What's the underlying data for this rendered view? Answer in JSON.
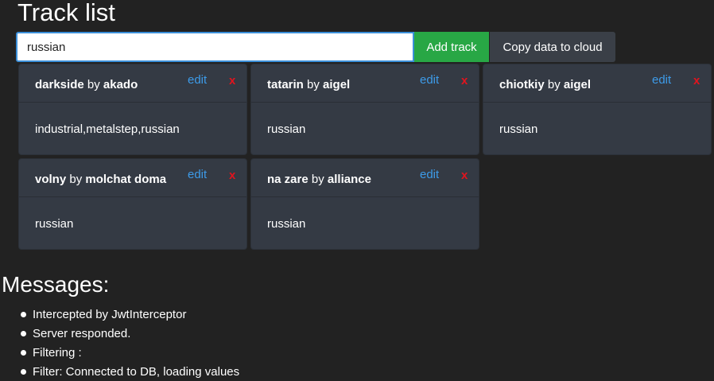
{
  "page": {
    "title": "Track list"
  },
  "toolbar": {
    "search_value": "russian",
    "add_label": "Add track",
    "copy_label": "Copy data to cloud"
  },
  "colors": {
    "background": "#222222",
    "card": "#343a44",
    "add_button": "#28a745",
    "edit_link": "#3d9be9",
    "delete": "#e0141e"
  },
  "tracks": [
    {
      "name": "darkside",
      "by": "by",
      "artist": "akado",
      "edit_label": "edit",
      "delete_label": "x",
      "tags": "industrial,metalstep,russian"
    },
    {
      "name": "tatarin",
      "by": "by",
      "artist": "aigel",
      "edit_label": "edit",
      "delete_label": "x",
      "tags": "russian"
    },
    {
      "name": "chiotkiy",
      "by": "by",
      "artist": "aigel",
      "edit_label": "edit",
      "delete_label": "x",
      "tags": "russian"
    },
    {
      "name": "volny",
      "by": "by",
      "artist": "molchat doma",
      "edit_label": "edit",
      "delete_label": "x",
      "tags": "russian"
    },
    {
      "name": "na zare",
      "by": "by",
      "artist": "alliance",
      "edit_label": "edit",
      "delete_label": "x",
      "tags": "russian"
    }
  ],
  "messages": {
    "title": "Messages:",
    "items": [
      "Intercepted by JwtInterceptor",
      "Server responded.",
      "Filtering :",
      "Filter: Connected to DB, loading values"
    ]
  }
}
